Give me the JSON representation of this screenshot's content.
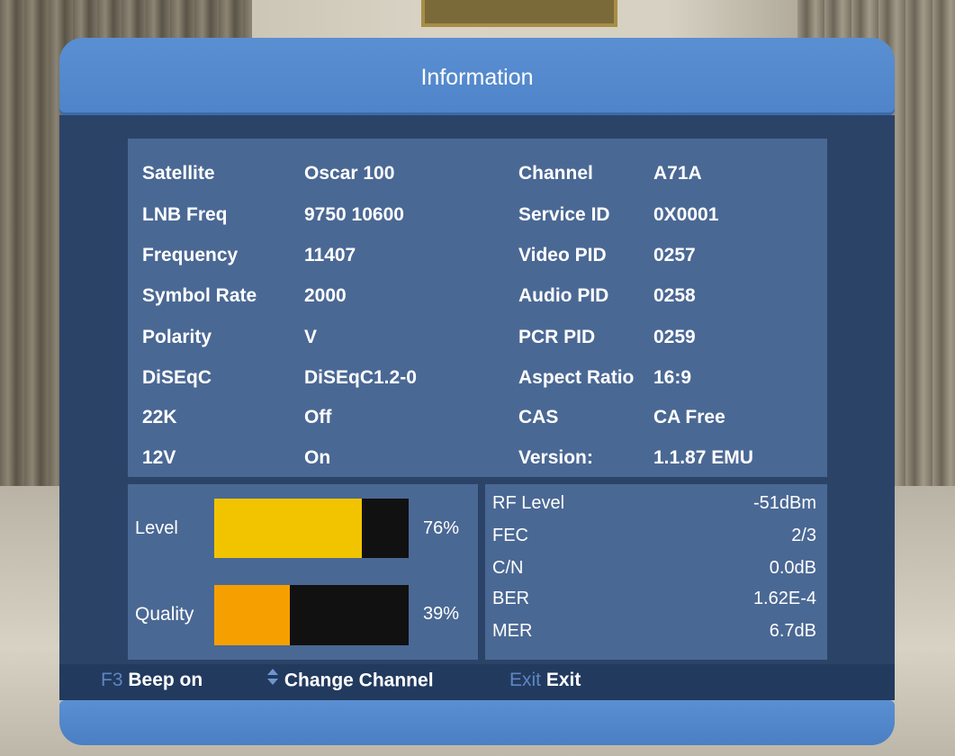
{
  "header": {
    "title": "Information"
  },
  "left_fields": [
    {
      "label": "Satellite",
      "value": "Oscar 100"
    },
    {
      "label": "LNB Freq",
      "value": "9750 10600"
    },
    {
      "label": "Frequency",
      "value": "11407"
    },
    {
      "label": "Symbol Rate",
      "value": "2000"
    },
    {
      "label": "Polarity",
      "value": "V"
    },
    {
      "label": "DiSEqC",
      "value": "DiSEqC1.2-0"
    },
    {
      "label": "22K",
      "value": "Off"
    },
    {
      "label": "12V",
      "value": "On"
    }
  ],
  "right_fields": [
    {
      "label": "Channel",
      "value": "A71A"
    },
    {
      "label": "Service ID",
      "value": "0X0001"
    },
    {
      "label": "Video PID",
      "value": "0257"
    },
    {
      "label": "Audio PID",
      "value": "0258"
    },
    {
      "label": "PCR PID",
      "value": "0259"
    },
    {
      "label": "Aspect Ratio",
      "value": "16:9"
    },
    {
      "label": "CAS",
      "value": "CA Free"
    },
    {
      "label": "Version:",
      "value": "1.1.87 EMU"
    }
  ],
  "signal": {
    "level": {
      "label": "Level",
      "percent_text": "76%",
      "fraction": 0.76,
      "color": "#f2c400"
    },
    "quality": {
      "label": "Quality",
      "percent_text": "39%",
      "fraction": 0.39,
      "color": "#f5a000"
    }
  },
  "rf_stats": [
    {
      "label": "RF Level",
      "value": "-51dBm"
    },
    {
      "label": "FEC",
      "value": "2/3"
    },
    {
      "label": "C/N",
      "value": "0.0dB"
    },
    {
      "label": "BER",
      "value": "1.62E-4"
    },
    {
      "label": "MER",
      "value": "6.7dB"
    }
  ],
  "footer": {
    "f3_key": "F3",
    "f3_label": "Beep on",
    "channel_icon": "up-down-arrows-icon",
    "channel_label": "Change Channel",
    "exit_key": "Exit",
    "exit_label": "Exit"
  },
  "colors": {
    "panel": "#4a6894",
    "body": "#2c4368",
    "header": "#5a8fd2"
  }
}
